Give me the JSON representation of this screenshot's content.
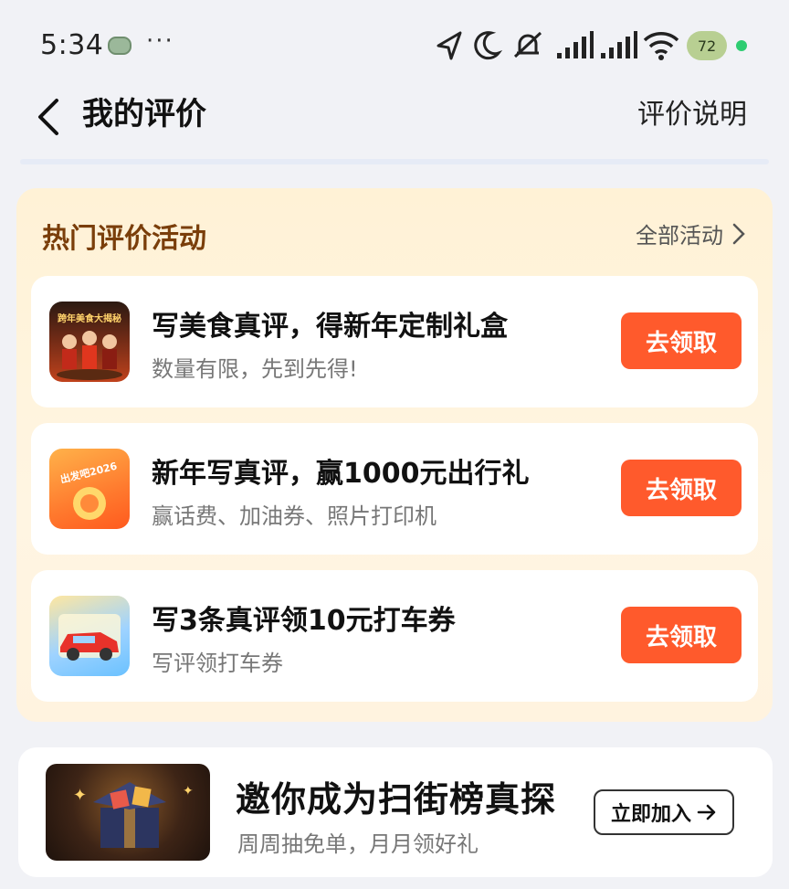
{
  "status_bar": {
    "time": "5:34",
    "more": "···",
    "battery": "72",
    "icons": [
      "location-icon",
      "moon-icon",
      "mute-icon",
      "signal-icon",
      "signal-icon",
      "wifi-icon"
    ]
  },
  "header": {
    "title": "我的评价",
    "link": "评价说明"
  },
  "activities": {
    "title": "热门评价活动",
    "all_link": "全部活动",
    "items": [
      {
        "title": "写美食真评，得新年定制礼盒",
        "subtitle": "数量有限，先到先得!",
        "thumb_text": "跨年美食大揭秘",
        "button": "去领取"
      },
      {
        "title": "新年写真评，赢1000元出行礼",
        "subtitle": "赢话费、加油券、照片打印机",
        "thumb_text": "出发吧2026",
        "button": "去领取"
      },
      {
        "title": "写3条真评领10元打车券",
        "subtitle": "写评领打车券",
        "button": "去领取"
      }
    ]
  },
  "invite": {
    "title": "邀你成为扫街榜真探",
    "subtitle": "周周抽免单，月月领好礼",
    "button": "立即加入"
  },
  "colors": {
    "accent": "#ff5a2c",
    "activity_bg": "#fff2d6",
    "activity_title": "#7a3e0a",
    "page_bg": "#f1f2f6"
  }
}
